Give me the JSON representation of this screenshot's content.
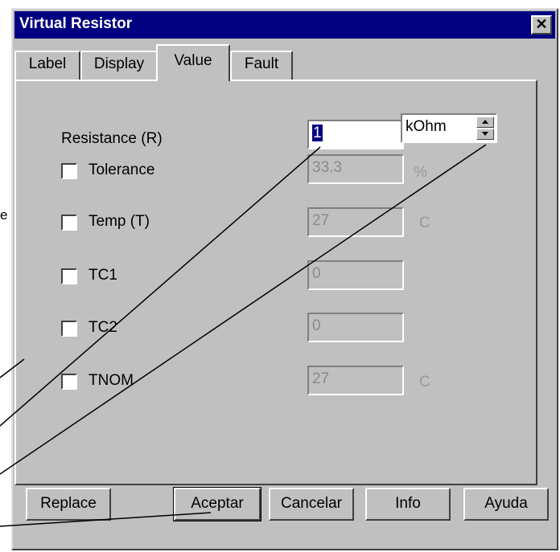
{
  "edge_text": "e",
  "window": {
    "title": "Virtual Resistor",
    "close_glyph": "✕"
  },
  "tabs": [
    {
      "label": "Label"
    },
    {
      "label": "Display"
    },
    {
      "label": "Value",
      "active": true
    },
    {
      "label": "Fault"
    }
  ],
  "fields": {
    "resistance": {
      "label": "Resistance (R)",
      "value": "1",
      "unit": "kOhm"
    },
    "tolerance": {
      "label": "Tolerance",
      "value": "33.3",
      "unit": "%"
    },
    "temp": {
      "label": "Temp (T)",
      "value": "27",
      "unit": "C"
    },
    "tc1": {
      "label": "TC1",
      "value": "0"
    },
    "tc2": {
      "label": "TC2",
      "value": "0"
    },
    "tnom": {
      "label": "TNOM",
      "value": "27",
      "unit": "C"
    }
  },
  "buttons": {
    "replace": "Replace",
    "accept": "Aceptar",
    "cancel": "Cancelar",
    "info": "Info",
    "help": "Ayuda"
  },
  "colors": {
    "titlebar": "#000080",
    "dialog": "#c0c0c0",
    "selection": "#000080"
  }
}
